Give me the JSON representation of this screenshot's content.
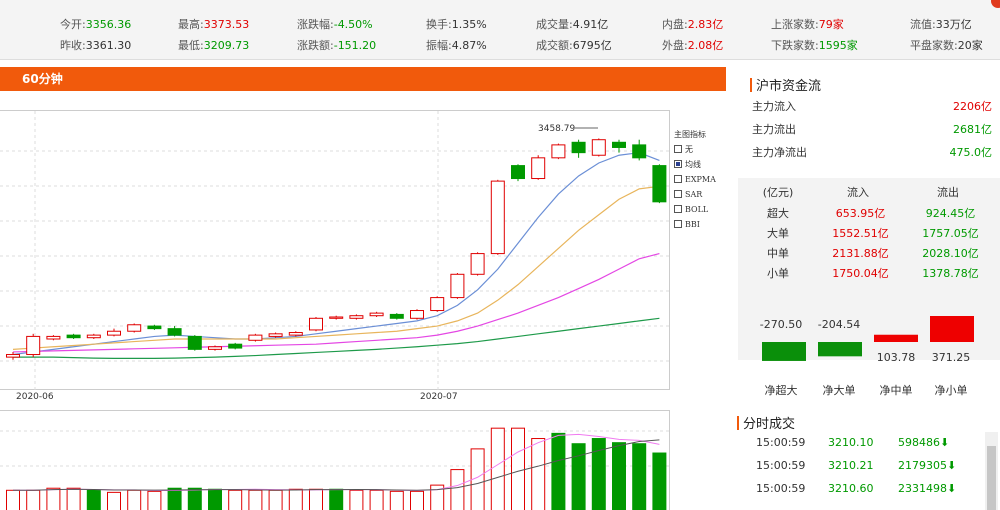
{
  "stats": {
    "open_label": "今开:",
    "open_value": "3356.36",
    "high_label": "最高:",
    "high_value": "3373.53",
    "pct_label": "涨跌幅:",
    "pct_value": "-4.50%",
    "turnover_label": "换手:",
    "turnover_value": "1.35%",
    "volume_label": "成交量:",
    "volume_value": "4.91亿",
    "inner_label": "内盘:",
    "inner_value": "2.83亿",
    "up_label": "上涨家数:",
    "up_value": "79家",
    "flow_label": "流值:",
    "flow_value": "33万亿",
    "prev_label": "昨收:",
    "prev_value": "3361.30",
    "low_label": "最低:",
    "low_value": "3209.73",
    "chg_label": "涨跌额:",
    "chg_value": "-151.20",
    "amp_label": "振幅:",
    "amp_value": "4.87%",
    "amount_label": "成交额:",
    "amount_value": "6795亿",
    "outer_label": "外盘:",
    "outer_value": "2.08亿",
    "down_label": "下跌家数:",
    "down_value": "1595家",
    "flat_label": "平盘家数:",
    "flat_value": "20家"
  },
  "chart_header": {
    "period": "60分钟"
  },
  "kline": {
    "max_label": "3458.79",
    "x_labels": [
      "2020-06",
      "2020-07"
    ],
    "candles": [
      {
        "o": 40,
        "c": 41,
        "h": 42,
        "l": 39
      },
      {
        "o": 41,
        "c": 48,
        "h": 49,
        "l": 40
      },
      {
        "o": 47,
        "c": 48,
        "h": 48.5,
        "l": 46.5
      },
      {
        "o": 48.5,
        "c": 47.5,
        "h": 49,
        "l": 47
      },
      {
        "o": 47.5,
        "c": 48.5,
        "h": 49,
        "l": 47
      },
      {
        "o": 48.5,
        "c": 50,
        "h": 51,
        "l": 48
      },
      {
        "o": 50,
        "c": 52.5,
        "h": 53,
        "l": 49.5
      },
      {
        "o": 52,
        "c": 51,
        "h": 52.5,
        "l": 50.5
      },
      {
        "o": 51,
        "c": 48.5,
        "h": 52,
        "l": 48
      },
      {
        "o": 48,
        "c": 43,
        "h": 48.5,
        "l": 42.5
      },
      {
        "o": 43,
        "c": 44,
        "h": 44.5,
        "l": 42.5
      },
      {
        "o": 45,
        "c": 43.5,
        "h": 45.5,
        "l": 43
      },
      {
        "o": 46.5,
        "c": 48.5,
        "h": 49,
        "l": 46
      },
      {
        "o": 48,
        "c": 49,
        "h": 49.5,
        "l": 47.5
      },
      {
        "o": 48.5,
        "c": 49.5,
        "h": 50,
        "l": 48
      },
      {
        "o": 50.5,
        "c": 55,
        "h": 55.5,
        "l": 50
      },
      {
        "o": 55,
        "c": 55.5,
        "h": 56,
        "l": 54.5
      },
      {
        "o": 55,
        "c": 56,
        "h": 56.5,
        "l": 54.5
      },
      {
        "o": 56,
        "c": 57,
        "h": 57.5,
        "l": 55.5
      },
      {
        "o": 56.5,
        "c": 55,
        "h": 57,
        "l": 54.5
      },
      {
        "o": 55,
        "c": 58,
        "h": 58.5,
        "l": 54.5
      },
      {
        "o": 58,
        "c": 63,
        "h": 63.5,
        "l": 57.5
      },
      {
        "o": 63,
        "c": 72,
        "h": 72.5,
        "l": 62.5
      },
      {
        "o": 72,
        "c": 80,
        "h": 80.5,
        "l": 71.5
      },
      {
        "o": 80,
        "c": 108,
        "h": 108.5,
        "l": 79.5
      },
      {
        "o": 114,
        "c": 109,
        "h": 114.5,
        "l": 108
      },
      {
        "o": 109,
        "c": 117,
        "h": 118,
        "l": 108.5
      },
      {
        "o": 117,
        "c": 122,
        "h": 122.5,
        "l": 116.5
      },
      {
        "o": 123,
        "c": 119,
        "h": 124,
        "l": 117
      },
      {
        "o": 118,
        "c": 124,
        "h": 124.5,
        "l": 117.5
      },
      {
        "o": 123,
        "c": 121,
        "h": 124,
        "l": 119
      },
      {
        "o": 122,
        "c": 117,
        "h": 124,
        "l": 116
      },
      {
        "o": 114,
        "c": 100,
        "h": 114.5,
        "l": 99.5
      }
    ],
    "ma_colors": [
      "#6b8fd6",
      "#e8b55c",
      "#e447e4",
      "#1e9a4a"
    ],
    "ma": [
      [
        41,
        42,
        43,
        44,
        45,
        46,
        47,
        48,
        48.5,
        48,
        47.5,
        47,
        47,
        47.5,
        48,
        49,
        50,
        51,
        52,
        53,
        54,
        56,
        60,
        66,
        74,
        84,
        94,
        103,
        110,
        115,
        118,
        119,
        116
      ],
      [
        43,
        43.5,
        44,
        44.5,
        45,
        45.5,
        46,
        46.5,
        47,
        47,
        47,
        47,
        47,
        47,
        47.5,
        48,
        48.5,
        49,
        49.5,
        50,
        51,
        52,
        54,
        57,
        62,
        68,
        75,
        82,
        89,
        95,
        101,
        105,
        106
      ],
      [
        42,
        42.2,
        42.4,
        42.6,
        42.8,
        43,
        43.2,
        43.4,
        43.6,
        43.8,
        44,
        44.2,
        44.4,
        44.6,
        44.8,
        45,
        45.5,
        46,
        46.5,
        47,
        47.5,
        48.5,
        50,
        52,
        54.5,
        57,
        60,
        63,
        66.5,
        70,
        74,
        78,
        80
      ],
      [
        40,
        40,
        40,
        39.8,
        39.6,
        39.5,
        39.5,
        39.5,
        39.6,
        39.8,
        40,
        40.3,
        40.6,
        41,
        41.4,
        41.8,
        42.2,
        42.6,
        43,
        43.5,
        44,
        44.6,
        45.2,
        46,
        47,
        48,
        49,
        50,
        51,
        52,
        53,
        54,
        55
      ]
    ]
  },
  "volume": {
    "bars": [
      20,
      20,
      22,
      22,
      20,
      18,
      20,
      19,
      22,
      22,
      21,
      20,
      20,
      20,
      21,
      21,
      21,
      20,
      20,
      19,
      19,
      25,
      40,
      60,
      80,
      80,
      70,
      75,
      65,
      70,
      66,
      65,
      56
    ],
    "colors": [
      "r",
      "r",
      "r",
      "r",
      "g",
      "r",
      "r",
      "r",
      "g",
      "g",
      "g",
      "r",
      "r",
      "r",
      "r",
      "r",
      "g",
      "r",
      "r",
      "r",
      "r",
      "r",
      "r",
      "r",
      "r",
      "r",
      "r",
      "g",
      "g",
      "g",
      "g",
      "g",
      "g"
    ]
  },
  "indicators": {
    "title": "主图指标",
    "items": [
      {
        "label": "无",
        "checked": false
      },
      {
        "label": "均线",
        "checked": true
      },
      {
        "label": "EXPMA",
        "checked": false
      },
      {
        "label": "SAR",
        "checked": false
      },
      {
        "label": "BOLL",
        "checked": false
      },
      {
        "label": "BBI",
        "checked": false
      }
    ]
  },
  "capital_flow": {
    "title": "沪市资金流",
    "inflow_label": "主力流入",
    "inflow_value": "2206亿",
    "outflow_label": "主力流出",
    "outflow_value": "2681亿",
    "net_label": "主力净流出",
    "net_value": "475.0亿",
    "table_headers": [
      "(亿元)",
      "流入",
      "流出"
    ],
    "rows": [
      {
        "label": "超大",
        "in": "653.95亿",
        "out": "924.45亿"
      },
      {
        "label": "大单",
        "in": "1552.51亿",
        "out": "1757.05亿"
      },
      {
        "label": "中单",
        "in": "2131.88亿",
        "out": "2028.10亿"
      },
      {
        "label": "小单",
        "in": "1750.04亿",
        "out": "1378.78亿"
      }
    ],
    "net_values": [
      "-270.50",
      "-204.54",
      "103.78",
      "371.25"
    ],
    "net_numbers": [
      -270.5,
      -204.54,
      103.78,
      371.25
    ],
    "net_labels": [
      "净超大",
      "净大单",
      "净中单",
      "净小单"
    ]
  },
  "trades": {
    "title": "分时成交",
    "rows": [
      {
        "time": "15:00:59",
        "price": "3210.10",
        "vol": "598486⬇"
      },
      {
        "time": "15:00:59",
        "price": "3210.21",
        "vol": "2179305⬇"
      },
      {
        "time": "15:00:59",
        "price": "3210.60",
        "vol": "2331498⬇"
      }
    ]
  }
}
